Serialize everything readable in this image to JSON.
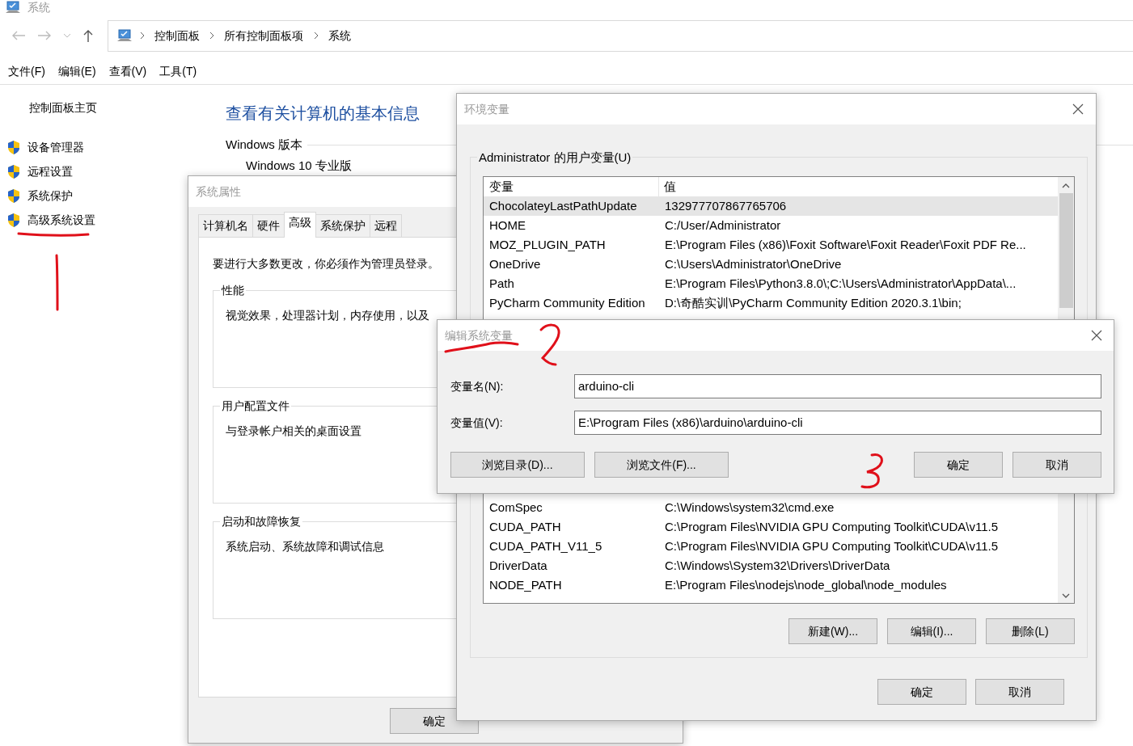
{
  "explorer": {
    "title": "系统",
    "breadcrumb": [
      "控制面板",
      "所有控制面板项",
      "系统"
    ],
    "menu": [
      "文件(F)",
      "编辑(E)",
      "查看(V)",
      "工具(T)"
    ],
    "sidebar_home": "控制面板主页",
    "sidebar_links": [
      "设备管理器",
      "远程设置",
      "系统保护",
      "高级系统设置"
    ],
    "heading": "查看有关计算机的基本信息",
    "section_title": "Windows 版本",
    "edition": "Windows 10 专业版"
  },
  "system_properties": {
    "title": "系统属性",
    "tabs": [
      {
        "label": "计算机名",
        "selected": false
      },
      {
        "label": "硬件",
        "selected": false
      },
      {
        "label": "高级",
        "selected": true
      },
      {
        "label": "系统保护",
        "selected": false
      },
      {
        "label": "远程",
        "selected": false
      }
    ],
    "notice": "要进行大多数更改，你必须作为管理员登录。",
    "groups": [
      {
        "title": "性能",
        "text": "视觉效果，处理器计划，内存使用，以及"
      },
      {
        "title": "用户配置文件",
        "text": "与登录帐户相关的桌面设置"
      },
      {
        "title": "启动和故障恢复",
        "text": "系统启动、系统故障和调试信息"
      }
    ],
    "buttons": [
      "确定"
    ]
  },
  "environment_variables": {
    "title": "环境变量",
    "user_group": "Administrator 的用户变量(U)",
    "columns": [
      "变量",
      "值"
    ],
    "user_rows": [
      {
        "name": "ChocolateyLastPathUpdate",
        "value": "132977707867765706",
        "selected": true
      },
      {
        "name": "HOME",
        "value": "C:/User/Administrator",
        "selected": false
      },
      {
        "name": "MOZ_PLUGIN_PATH",
        "value": "E:\\Program Files (x86)\\Foxit Software\\Foxit Reader\\Foxit PDF Re...",
        "selected": false
      },
      {
        "name": "OneDrive",
        "value": "C:\\Users\\Administrator\\OneDrive",
        "selected": false
      },
      {
        "name": "Path",
        "value": "E:\\Program Files\\Python3.8.0\\;C:\\Users\\Administrator\\AppData\\...",
        "selected": false
      },
      {
        "name": "PyCharm Community Edition",
        "value": "D:\\奇酷实训\\PyCharm Community Edition 2020.3.1\\bin;",
        "selected": false
      }
    ],
    "system_rows": [
      {
        "name": "ComSpec",
        "value": "C:\\Windows\\system32\\cmd.exe"
      },
      {
        "name": "CUDA_PATH",
        "value": "C:\\Program Files\\NVIDIA GPU Computing Toolkit\\CUDA\\v11.5"
      },
      {
        "name": "CUDA_PATH_V11_5",
        "value": "C:\\Program Files\\NVIDIA GPU Computing Toolkit\\CUDA\\v11.5"
      },
      {
        "name": "DriverData",
        "value": "C:\\Windows\\System32\\Drivers\\DriverData"
      },
      {
        "name": "NODE_PATH",
        "value": "E:\\Program Files\\nodejs\\node_global\\node_modules"
      }
    ],
    "list_buttons": [
      "新建(W)...",
      "编辑(I)...",
      "删除(L)"
    ],
    "buttons": [
      "确定",
      "取消"
    ]
  },
  "edit_dialog": {
    "title": "编辑系统变量",
    "fields": [
      {
        "label": "变量名(N):",
        "value": "arduino-cli"
      },
      {
        "label": "变量值(V):",
        "value": "E:\\Program Files (x86)\\arduino\\arduino-cli"
      }
    ],
    "browse_buttons": [
      "浏览目录(D)...",
      "浏览文件(F)..."
    ],
    "buttons": [
      "确定",
      "取消"
    ]
  }
}
